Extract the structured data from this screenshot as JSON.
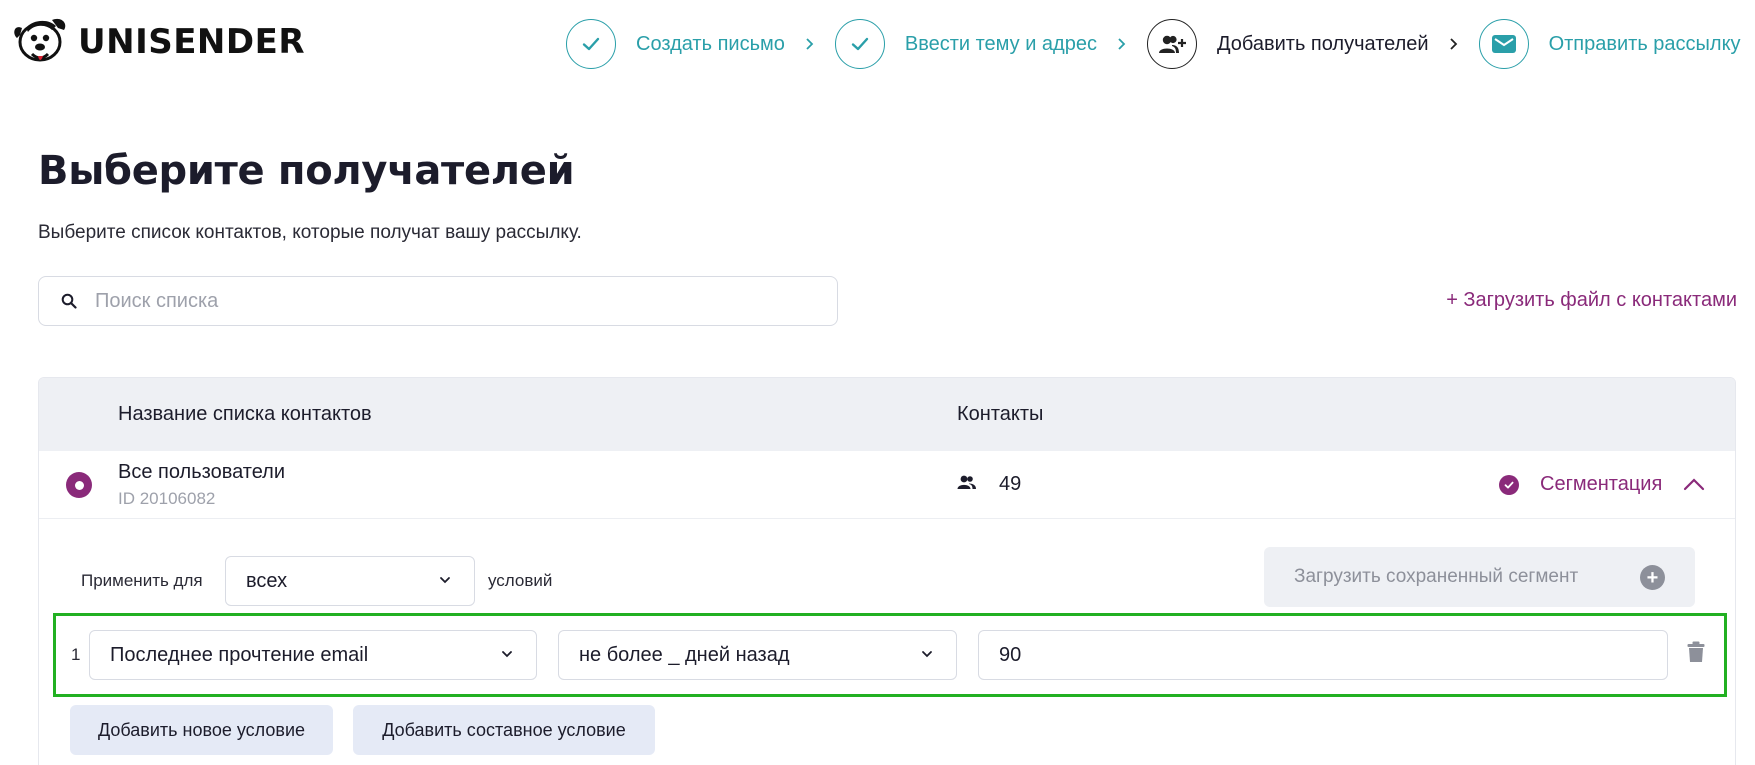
{
  "brand": {
    "name": "UNISENDER"
  },
  "steps": [
    {
      "label": "Создать письмо",
      "status": "done",
      "icon": "check-icon"
    },
    {
      "label": "Ввести тему и адрес",
      "status": "done",
      "icon": "check-icon"
    },
    {
      "label": "Добавить получателей",
      "status": "current",
      "icon": "add-user-icon"
    },
    {
      "label": "Отправить рассылку",
      "status": "upcoming",
      "icon": "envelope-icon"
    }
  ],
  "page": {
    "title": "Выберите получателей",
    "subtitle": "Выберите список контактов, которые получат вашу рассылку."
  },
  "search": {
    "placeholder": "Поиск списка",
    "value": ""
  },
  "upload_link": "+ Загрузить файл с контактами",
  "table": {
    "headers": {
      "name": "Название списка контактов",
      "contacts": "Контакты"
    },
    "rows": [
      {
        "name": "Все пользователи",
        "id": "ID 20106082",
        "contacts": "49",
        "selected": true,
        "segmentation": "Сегментация"
      }
    ]
  },
  "segmentation": {
    "apply_label": "Применить для",
    "apply_value": "всех",
    "conditions_label": "условий",
    "load_saved": "Загрузить сохраненный сегмент",
    "conditions": [
      {
        "num": "1",
        "field": "Последнее прочтение email",
        "operator": "не более _ дней назад",
        "value": "90"
      }
    ],
    "add_condition": "Добавить новое условие",
    "add_compound": "Добавить составное условие"
  },
  "colors": {
    "accent_teal": "#2a9fa9",
    "accent_purple": "#8a2a7a",
    "highlight_green": "#22b022"
  }
}
